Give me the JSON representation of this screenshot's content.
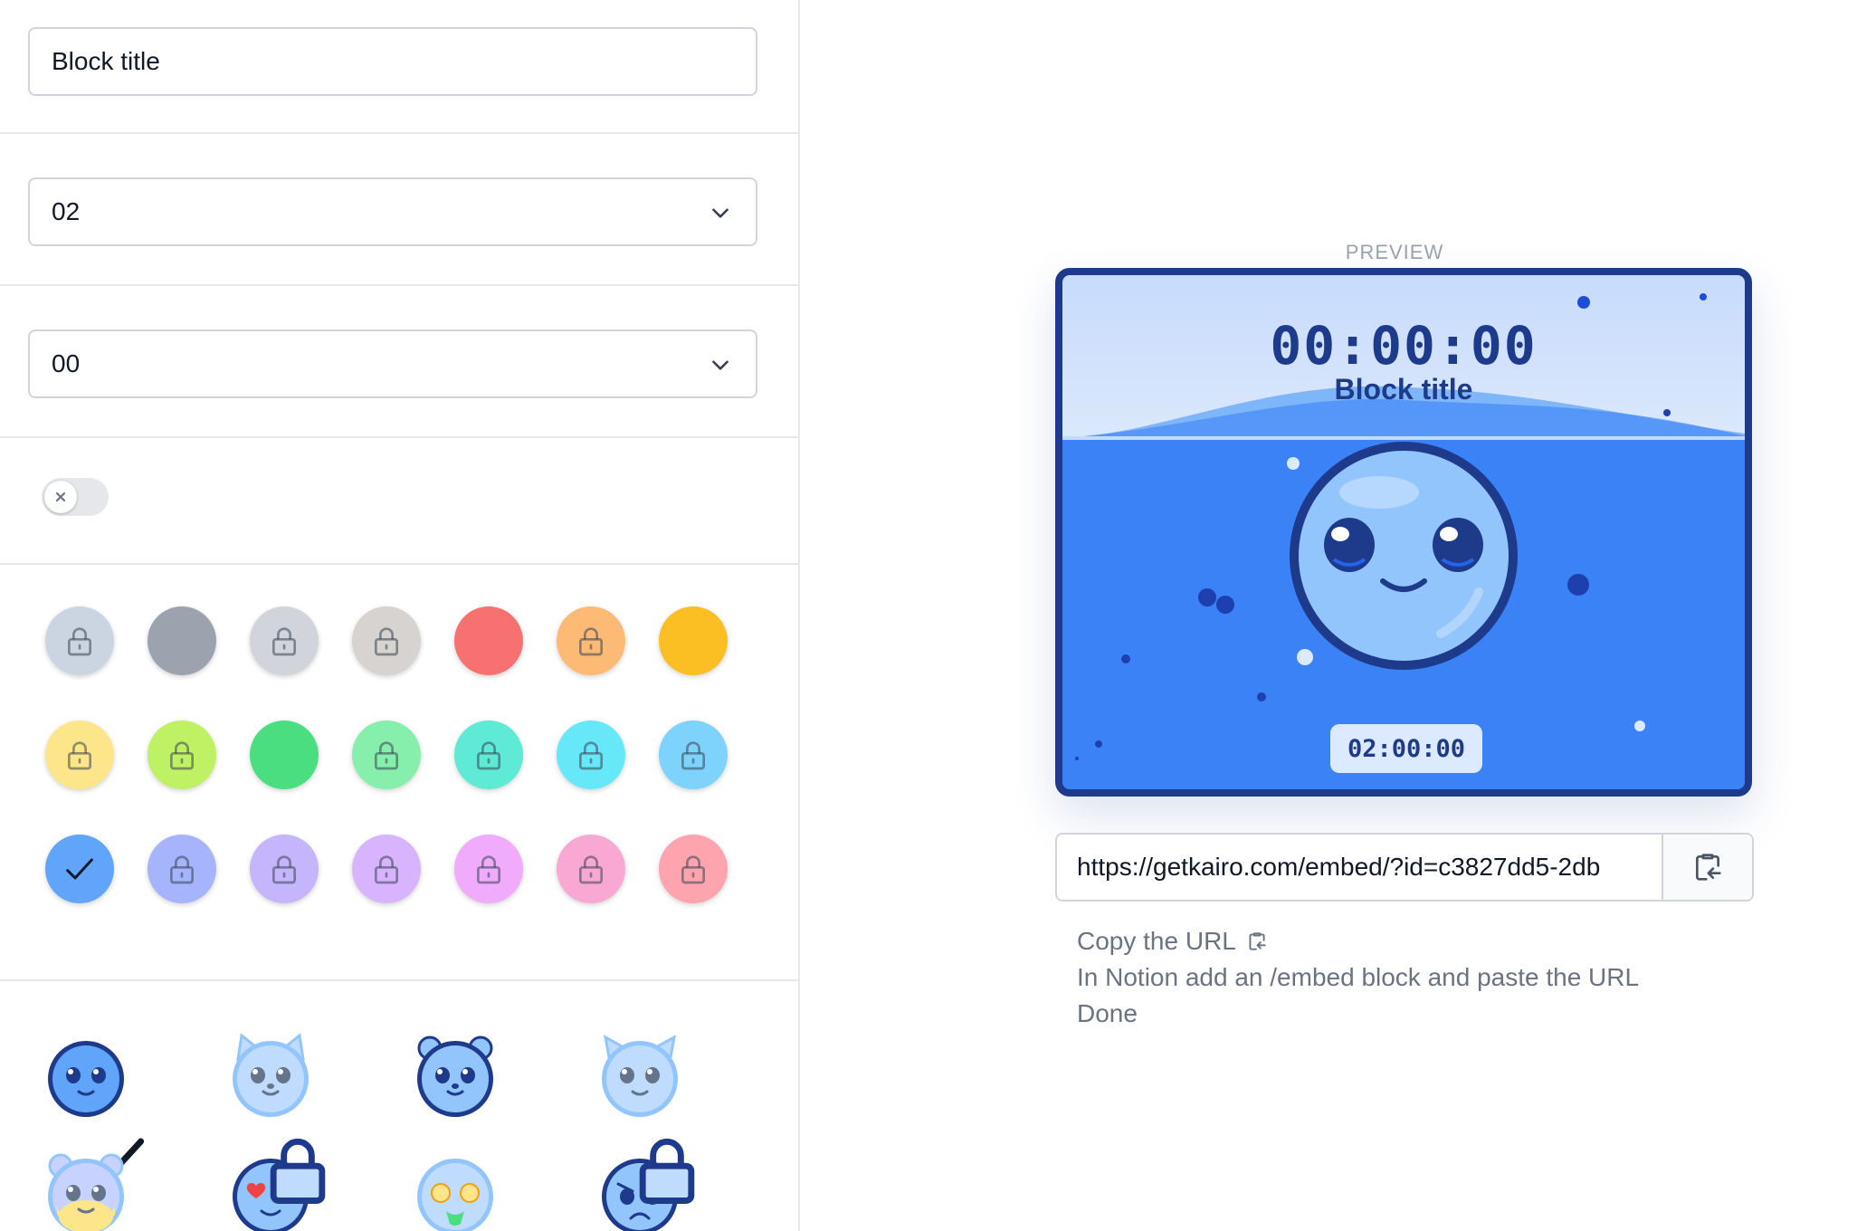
{
  "settings": {
    "title_value": "Block title",
    "hours_select": "02",
    "minutes_select": "00",
    "toggle_on": false
  },
  "colors": [
    {
      "hex": "#cbd5e1",
      "locked": true,
      "selected": false
    },
    {
      "hex": "#9ca3af",
      "locked": false,
      "selected": false
    },
    {
      "hex": "#d1d5db",
      "locked": true,
      "selected": false
    },
    {
      "hex": "#d6d3d1",
      "locked": true,
      "selected": false
    },
    {
      "hex": "#f87171",
      "locked": false,
      "selected": false
    },
    {
      "hex": "#fdba74",
      "locked": true,
      "selected": false
    },
    {
      "hex": "#fbbf24",
      "locked": false,
      "selected": false
    },
    {
      "hex": "#fde68a",
      "locked": true,
      "selected": false
    },
    {
      "hex": "#bef264",
      "locked": true,
      "selected": false
    },
    {
      "hex": "#4ade80",
      "locked": false,
      "selected": false
    },
    {
      "hex": "#86efac",
      "locked": true,
      "selected": false
    },
    {
      "hex": "#5eead4",
      "locked": true,
      "selected": false
    },
    {
      "hex": "#67e8f9",
      "locked": true,
      "selected": false
    },
    {
      "hex": "#7dd3fc",
      "locked": true,
      "selected": false
    },
    {
      "hex": "#60a5fa",
      "locked": false,
      "selected": true
    },
    {
      "hex": "#a5b4fc",
      "locked": true,
      "selected": false
    },
    {
      "hex": "#c4b5fd",
      "locked": true,
      "selected": false
    },
    {
      "hex": "#d8b4fe",
      "locked": true,
      "selected": false
    },
    {
      "hex": "#f0abfc",
      "locked": true,
      "selected": false
    },
    {
      "hex": "#f9a8d4",
      "locked": true,
      "selected": false
    },
    {
      "hex": "#fda4af",
      "locked": true,
      "selected": false
    }
  ],
  "characters": [
    {
      "icon": "blob-face-icon",
      "locked": false,
      "selected": true
    },
    {
      "icon": "cat-face-icon",
      "locked": false,
      "selected": false
    },
    {
      "icon": "bear-face-icon",
      "locked": false,
      "selected": false
    },
    {
      "icon": "owl-face-icon",
      "locked": false,
      "selected": false
    },
    {
      "icon": "hamster-face-icon",
      "locked": false,
      "selected": false
    },
    {
      "icon": "heart-eyes-face-icon",
      "locked": true,
      "selected": false
    },
    {
      "icon": "money-face-icon",
      "locked": false,
      "selected": false
    },
    {
      "icon": "angry-face-icon",
      "locked": true,
      "selected": false
    }
  ],
  "preview": {
    "label": "PREVIEW",
    "timer": "00:00:00",
    "title": "Block title",
    "goal": "02:00:00",
    "accent": "#3b82f6",
    "frame": "#1e3a8a"
  },
  "embed": {
    "url": "https://getkairo.com/embed/?id=c3827dd5-2db",
    "steps": [
      "Copy the URL",
      "In Notion add an /embed block and paste the URL",
      "Done"
    ]
  }
}
